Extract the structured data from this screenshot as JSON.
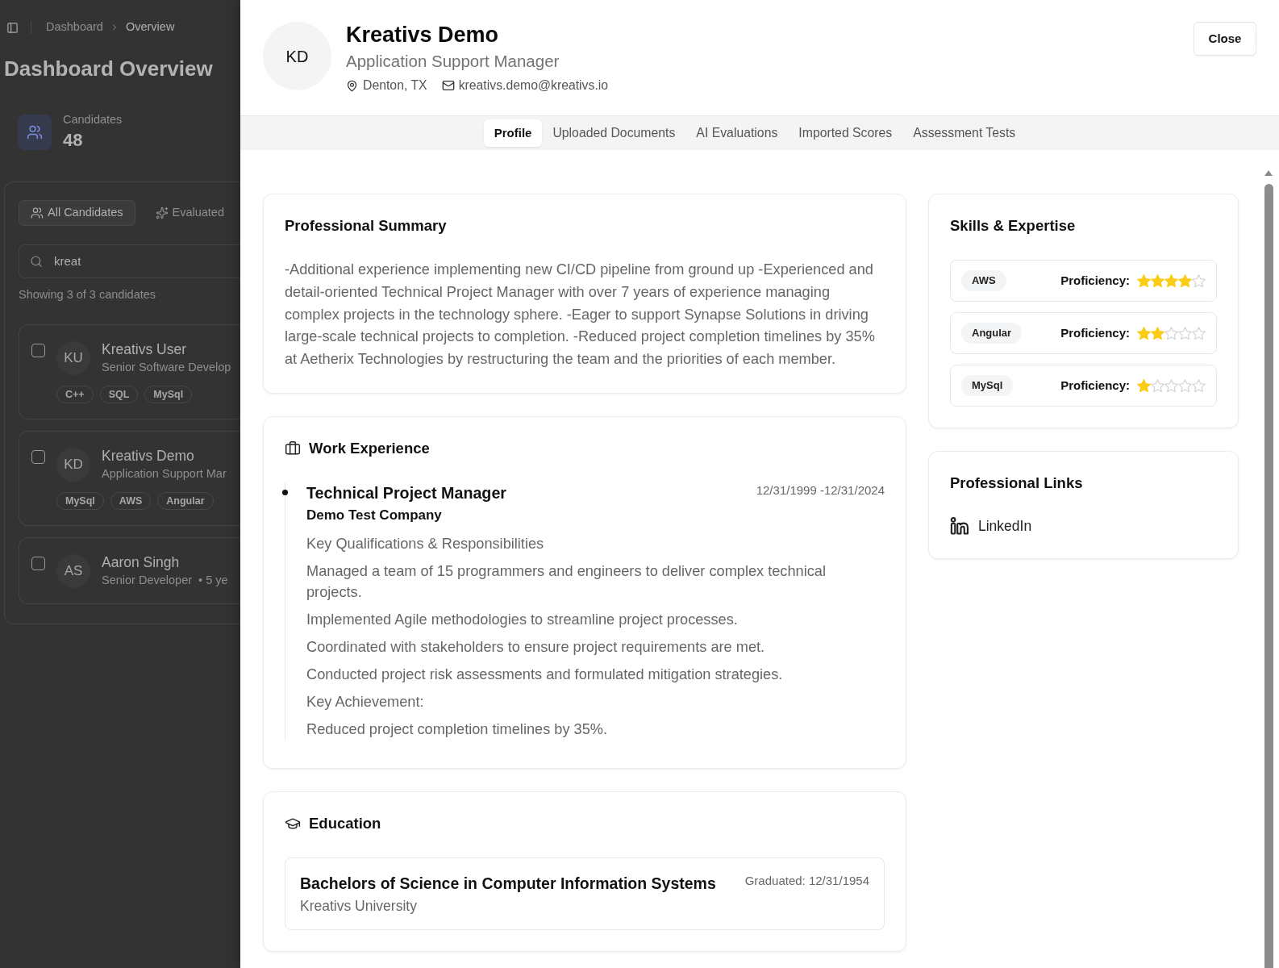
{
  "background": {
    "breadcrumbs": [
      "Dashboard",
      "Overview"
    ],
    "title": "Dashboard Overview",
    "stat": {
      "label": "Candidates",
      "value": "48"
    },
    "filter_tabs": [
      {
        "label": "All Candidates",
        "selected": true
      },
      {
        "label": "Evaluated",
        "selected": false
      }
    ],
    "search": {
      "value": "kreat"
    },
    "result_count": "Showing 3 of 3 candidates",
    "candidates": [
      {
        "initials": "KU",
        "name": "Kreativs User",
        "role": "Senior Software Develop",
        "checked": false,
        "skills": [
          "C++",
          "SQL",
          "MySql"
        ]
      },
      {
        "initials": "KD",
        "name": "Kreativs Demo",
        "role": "Application Support Mar",
        "checked": false,
        "skills": [
          "MySql",
          "AWS",
          "Angular"
        ]
      },
      {
        "initials": "AS",
        "name": "Aaron Singh",
        "role": "Senior Developer",
        "meta": "• 5 ye",
        "checked": false
      }
    ]
  },
  "profile": {
    "initials": "KD",
    "name": "Kreativs Demo",
    "title": "Application Support Manager",
    "location": "Denton, TX",
    "email": "kreativs.demo@kreativs.io"
  },
  "close_button": "Close",
  "tabs": [
    {
      "label": "Profile",
      "selected": true
    },
    {
      "label": "Uploaded Documents",
      "selected": false
    },
    {
      "label": "AI Evaluations",
      "selected": false
    },
    {
      "label": "Imported Scores",
      "selected": false
    },
    {
      "label": "Assessment Tests",
      "selected": false
    }
  ],
  "summary": {
    "heading": "Professional Summary",
    "text": "-Additional experience implementing new CI/CD pipeline from ground up -Experienced and detail-oriented Technical Project Manager with over 7 years of experience managing complex projects in the technology sphere. -Eager to support Synapse Solutions in driving large-scale technical projects to completion. -Reduced project completion timelines by 35% at Aetherix Technologies by restructuring the team and the priorities of each member."
  },
  "work_experience": {
    "heading": "Work Experience",
    "jobs": [
      {
        "title": "Technical Project Manager",
        "company": "Demo Test Company",
        "dates": "12/31/1999 -12/31/2024",
        "lines": [
          "Key Qualifications & Responsibilities",
          "Managed a team of 15 programmers and engineers to deliver complex technical projects.",
          "Implemented Agile methodologies to streamline project processes.",
          "Coordinated with stakeholders to ensure project requirements are met.",
          "Conducted project risk assessments and formulated mitigation strategies.",
          "Key Achievement:",
          "Reduced project completion timelines by 35%."
        ]
      }
    ]
  },
  "education": {
    "heading": "Education",
    "entries": [
      {
        "degree": "Bachelors of Science in Computer Information Systems",
        "school": "Kreativs University",
        "graduated": "Graduated: 12/31/1954"
      }
    ]
  },
  "skills": {
    "heading": "Skills & Expertise",
    "items": [
      {
        "name": "AWS",
        "label": "Proficiency:",
        "stars": 4
      },
      {
        "name": "Angular",
        "label": "Proficiency:",
        "stars": 2
      },
      {
        "name": "MySql",
        "label": "Proficiency:",
        "stars": 1
      }
    ]
  },
  "links": {
    "heading": "Professional Links",
    "items": [
      {
        "label": "LinkedIn"
      }
    ]
  }
}
